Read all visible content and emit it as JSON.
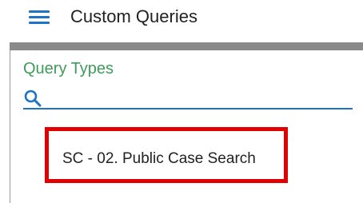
{
  "header": {
    "title": "Custom Queries",
    "menu_icon": "hamburger-menu-icon"
  },
  "panel": {
    "section_label": "Query Types",
    "search": {
      "icon": "search-icon",
      "value": "",
      "placeholder": ""
    },
    "items": [
      {
        "label": "SC - 02. Public Case Search"
      }
    ]
  },
  "colors": {
    "accent": "#1f73c4",
    "section_label": "#3f9a5c",
    "highlight": "#e00000",
    "divider": "#8a8a8a"
  }
}
